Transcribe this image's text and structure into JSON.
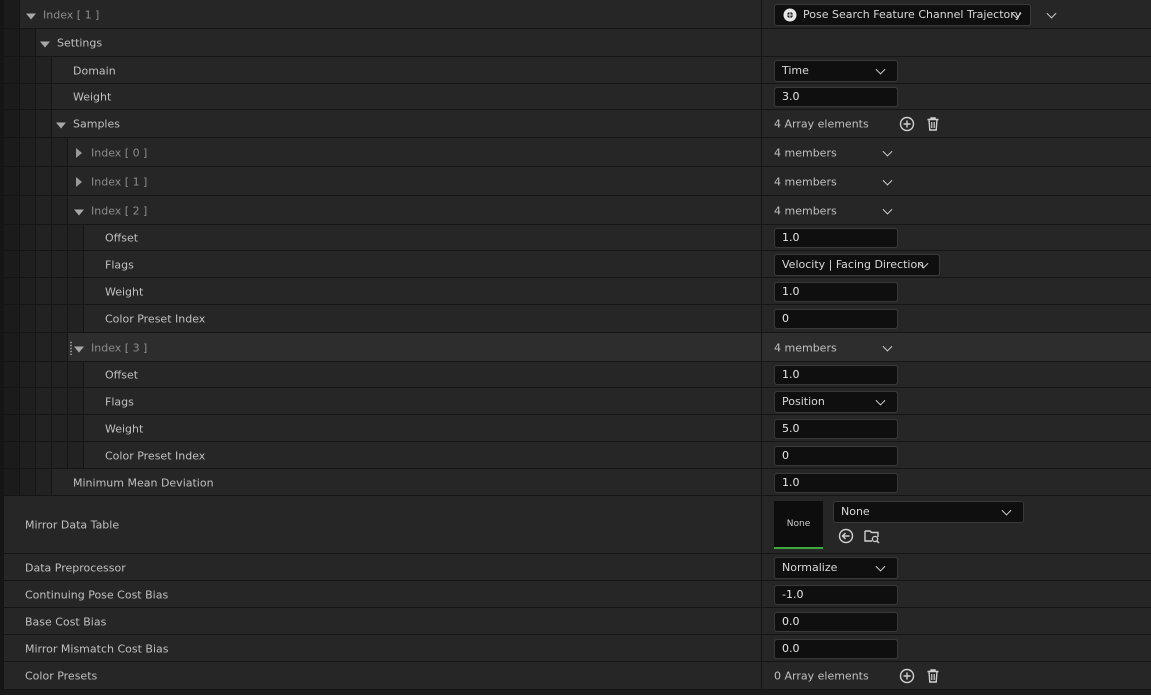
{
  "rows": {
    "index1": {
      "label": "Index [ 1 ]",
      "combo": "Pose Search Feature Channel Trajectory"
    },
    "settings": {
      "label": "Settings"
    },
    "domain": {
      "label": "Domain",
      "value": "Time"
    },
    "weight": {
      "label": "Weight",
      "value": "3.0"
    },
    "samples": {
      "label": "Samples",
      "value": "4 Array elements"
    },
    "s0": {
      "label": "Index [ 0 ]",
      "value": "4 members"
    },
    "s1": {
      "label": "Index [ 1 ]",
      "value": "4 members"
    },
    "s2": {
      "label": "Index [ 2 ]",
      "value": "4 members"
    },
    "s2_offset": {
      "label": "Offset",
      "value": "1.0"
    },
    "s2_flags": {
      "label": "Flags",
      "value": "Velocity | Facing Direction"
    },
    "s2_weight": {
      "label": "Weight",
      "value": "1.0"
    },
    "s2_color": {
      "label": "Color Preset Index",
      "value": "0"
    },
    "s3": {
      "label": "Index [ 3 ]",
      "value": "4 members"
    },
    "s3_offset": {
      "label": "Offset",
      "value": "1.0"
    },
    "s3_flags": {
      "label": "Flags",
      "value": "Position"
    },
    "s3_weight": {
      "label": "Weight",
      "value": "5.0"
    },
    "s3_color": {
      "label": "Color Preset Index",
      "value": "0"
    },
    "min_mean_dev": {
      "label": "Minimum Mean Deviation",
      "value": "1.0"
    },
    "mirror_table": {
      "label": "Mirror Data Table",
      "thumb": "None",
      "value": "None"
    },
    "preprocessor": {
      "label": "Data Preprocessor",
      "value": "Normalize"
    },
    "cont_pose_bias": {
      "label": "Continuing Pose Cost Bias",
      "value": "-1.0"
    },
    "base_cost_bias": {
      "label": "Base Cost Bias",
      "value": "0.0"
    },
    "mirror_mismatch": {
      "label": "Mirror Mismatch Cost Bias",
      "value": "0.0"
    },
    "color_presets": {
      "label": "Color Presets",
      "value": "0 Array elements"
    }
  },
  "icons": {
    "add": "plus-circle-icon",
    "delete": "trash-icon",
    "chevron": "chevron-down-icon",
    "expand": "triangle-down-icon",
    "collapse": "triangle-right-icon",
    "class": "class-icon",
    "use_selected": "arrow-left-circle-icon",
    "browse": "folder-search-icon"
  },
  "colors": {
    "background": "#151515",
    "row": "#262626",
    "field": "#0f0f0f",
    "accent_green": "#3fa73f"
  }
}
